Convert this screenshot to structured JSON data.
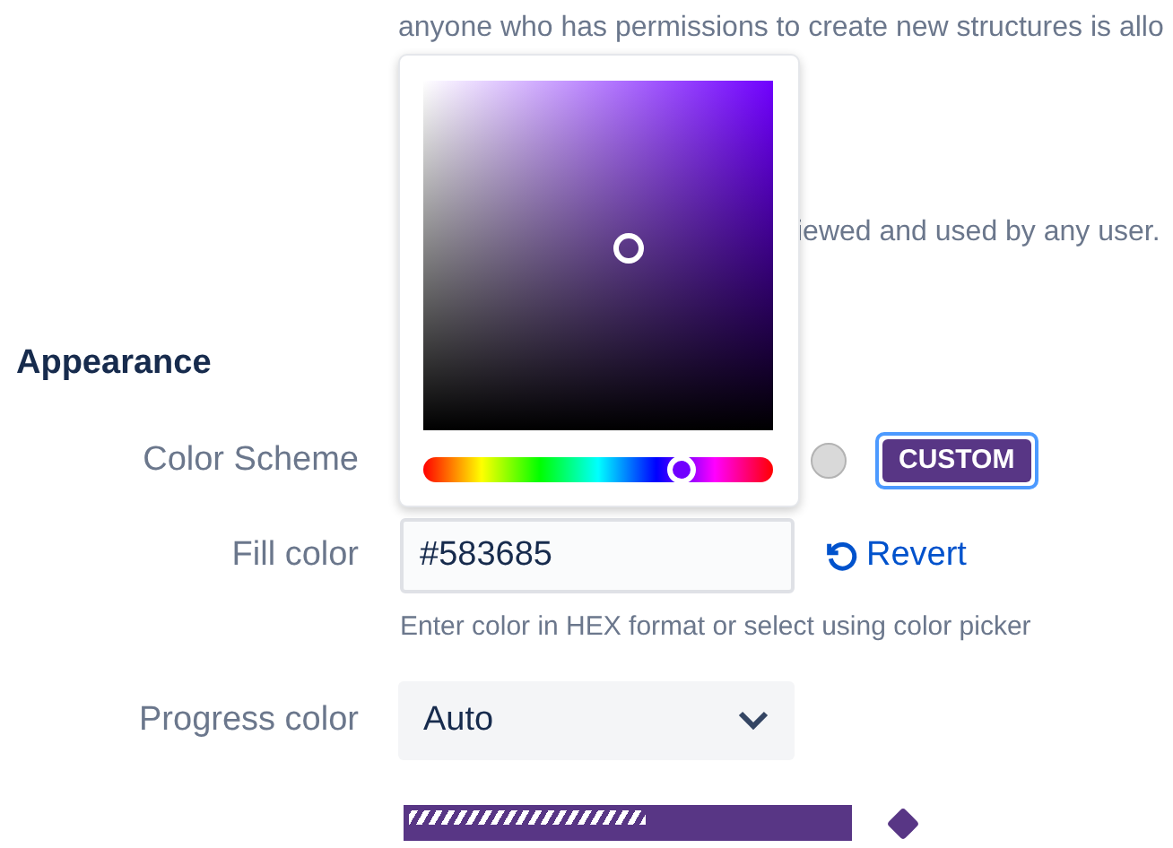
{
  "intro_text": "anyone who has permissions to create new structures is allo",
  "visibility_text": "iewed and used by any user.",
  "section_title": "Appearance",
  "color_scheme": {
    "label": "Color Scheme",
    "options": [
      {
        "kind": "swatch",
        "color": "#d9d9d9",
        "selected": false
      },
      {
        "kind": "custom",
        "label": "CUSTOM",
        "color": "#583685",
        "selected": true
      }
    ]
  },
  "color_picker": {
    "open": true,
    "hue_slider": {
      "level": 0.74
    }
  },
  "fill_color": {
    "label": "Fill color",
    "value": "#583685",
    "revert": "Revert",
    "hint": "Enter color in HEX format or select using color picker"
  },
  "progress_color": {
    "label": "Progress color",
    "value": "Auto"
  },
  "preview": {
    "level": 0.54
  }
}
